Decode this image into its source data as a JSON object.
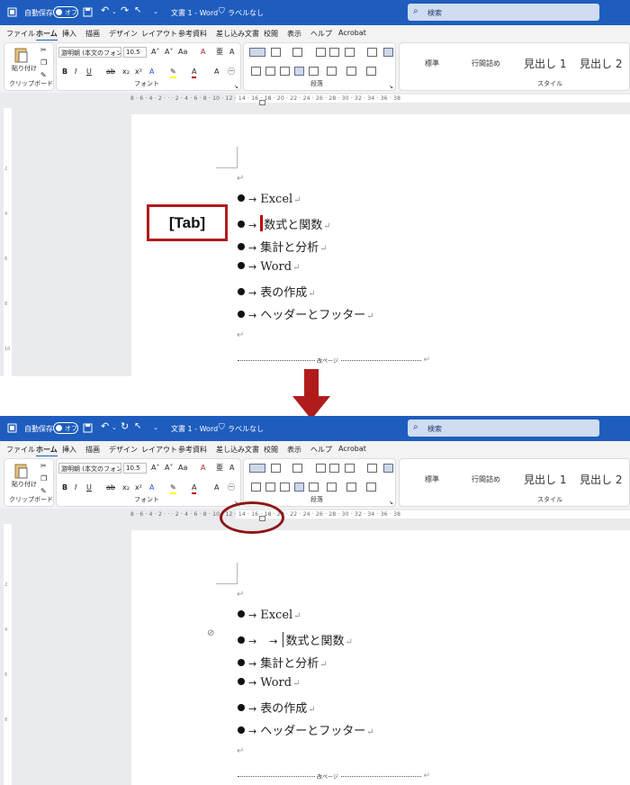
{
  "app": {
    "autosave_label": "自動保存",
    "autosave_state": "オフ",
    "doc_title": "文書 1 - Word",
    "sensitivity": "ラベルなし",
    "search_placeholder": "検索",
    "brand_color": "#1e5dbe"
  },
  "menu": [
    "ファイル",
    "ホーム",
    "挿入",
    "描画",
    "デザイン",
    "レイアウト",
    "参考資料",
    "差し込み文書",
    "校閲",
    "表示",
    "ヘルプ",
    "Acrobat"
  ],
  "ribbon": {
    "paste_label": "貼り付け",
    "clipboard_group": "クリップボード",
    "font_name": "游明朝 (本文のフォン",
    "font_size": "10.5",
    "font_group": "フォント",
    "paragraph_group": "段落",
    "styles": [
      "標準",
      "行間詰め",
      "見出し 1",
      "見出し 2"
    ],
    "style_group": "スタイル"
  },
  "document": {
    "items": [
      "Excel",
      "数式と関数",
      "集計と分析",
      "Word",
      "表の作成",
      "ヘッダーとフッター"
    ],
    "page_break_label": "改ページ",
    "para_mark": "↵",
    "tab_arrow": "→"
  },
  "annotation": {
    "tab_key_label": "[Tab]",
    "accent_color": "#b01c1c"
  }
}
